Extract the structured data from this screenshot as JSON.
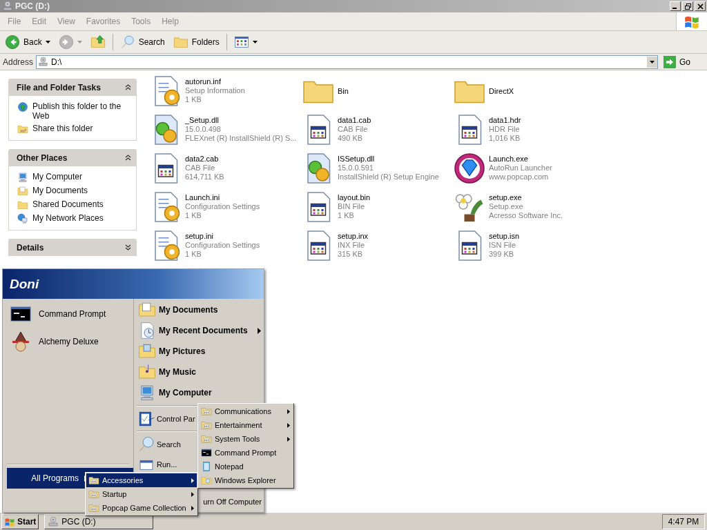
{
  "window": {
    "title": "PGC (D:)"
  },
  "menu_bar": [
    "File",
    "Edit",
    "View",
    "Favorites",
    "Tools",
    "Help"
  ],
  "toolbar": {
    "back": "Back",
    "forward": {
      "disabled": true
    },
    "search": "Search",
    "folders": "Folders"
  },
  "address": {
    "label": "Address",
    "value": "D:\\",
    "go": "Go"
  },
  "task_panels": [
    {
      "title": "File and Folder Tasks",
      "expanded": true,
      "items": [
        {
          "label": "Publish this folder to the Web",
          "kind": "globe"
        },
        {
          "label": "Share this folder",
          "kind": "share"
        }
      ]
    },
    {
      "title": "Other Places",
      "expanded": true,
      "items": [
        {
          "label": "My Computer",
          "kind": "computer"
        },
        {
          "label": "My Documents",
          "kind": "documents"
        },
        {
          "label": "Shared Documents",
          "kind": "folder"
        },
        {
          "label": "My Network Places",
          "kind": "network"
        }
      ]
    },
    {
      "title": "Details",
      "expanded": false
    }
  ],
  "files": [
    {
      "name": "autorun.inf",
      "kind": "config",
      "line_2": "Setup Information",
      "line_3": "1 KB"
    },
    {
      "name": "Bin",
      "kind": "folder"
    },
    {
      "name": "DirectX",
      "kind": "folder"
    },
    {
      "name": "_Setup.dll",
      "kind": "library",
      "line_2": "15.0.0.498",
      "line_3": "FLEXnet (R) InstallShield (R) S..."
    },
    {
      "name": "data1.cab",
      "kind": "package",
      "line_2": "CAB File",
      "line_3": "490 KB"
    },
    {
      "name": "data1.hdr",
      "kind": "package",
      "line_2": "HDR File",
      "line_3": "1,016 KB"
    },
    {
      "name": "data2.cab",
      "kind": "package",
      "line_2": "CAB File",
      "line_3": "614,711 KB"
    },
    {
      "name": "ISSetup.dll",
      "kind": "library",
      "line_2": "15.0.0.591",
      "line_3": "InstallShield (R) Setup Engine"
    },
    {
      "name": "Launch.exe",
      "kind": "gem",
      "line_2": "AutoRun Launcher",
      "line_3": "www.popcap.com"
    },
    {
      "name": "Launch.ini",
      "kind": "config",
      "line_2": "Configuration Settings",
      "line_3": "1 KB"
    },
    {
      "name": "layout.bin",
      "kind": "package",
      "line_2": "BIN File",
      "line_3": "1 KB"
    },
    {
      "name": "setup.exe",
      "kind": "flower",
      "line_2": "Setup.exe",
      "line_3": "Acresso Software Inc."
    },
    {
      "name": "setup.ini",
      "kind": "config",
      "line_2": "Configuration Settings",
      "line_3": "1 KB"
    },
    {
      "name": "setup.inx",
      "kind": "package",
      "line_2": "INX File",
      "line_3": "315 KB"
    },
    {
      "name": "setup.isn",
      "kind": "package",
      "line_2": "ISN File",
      "line_3": "399 KB"
    }
  ],
  "start_menu": {
    "user": "Doni",
    "pinned": [
      {
        "label": "Command Prompt",
        "kind": "console"
      },
      {
        "label": "Alchemy Deluxe",
        "kind": "hat"
      }
    ],
    "all_programs": {
      "label": "All Programs",
      "selected": true
    },
    "places": [
      {
        "label": "My Documents",
        "kind": "documents",
        "submenu": false
      },
      {
        "label": "My Recent Documents",
        "kind": "recent",
        "submenu": true
      },
      {
        "label": "My Pictures",
        "kind": "pictures",
        "submenu": false
      },
      {
        "label": "My Music",
        "kind": "music",
        "submenu": false
      },
      {
        "label": "My Computer",
        "kind": "computer",
        "submenu": false
      }
    ],
    "system": [
      {
        "label": "Control Par",
        "kind": "control"
      },
      {
        "label": "Search",
        "kind": "search"
      },
      {
        "label": "Run...",
        "kind": "run"
      }
    ],
    "turn_off": "urn Off Computer"
  },
  "programs_menu": [
    {
      "label": "Accessories",
      "kind": "progfolder",
      "submenu": true,
      "selected": true
    },
    {
      "label": "Startup",
      "kind": "progfolder",
      "submenu": true,
      "selected": false
    },
    {
      "label": "Popcap Game Collection",
      "kind": "progfolder",
      "submenu": true,
      "selected": false
    }
  ],
  "accessories_menu": [
    {
      "label": "Communications",
      "kind": "progfolder",
      "submenu": true
    },
    {
      "label": "Entertainment",
      "kind": "progfolder",
      "submenu": true
    },
    {
      "label": "System Tools",
      "kind": "progfolder",
      "submenu": true
    },
    {
      "label": "Command Prompt",
      "kind": "console",
      "submenu": false
    },
    {
      "label": "Notepad",
      "kind": "notepad",
      "submenu": false
    },
    {
      "label": "Windows Explorer",
      "kind": "explorer",
      "submenu": false
    }
  ],
  "taskbar": {
    "start": "Start",
    "tasks": [
      {
        "label": "PGC (D:)",
        "kind": "drive"
      }
    ],
    "clock": "4:47 PM"
  }
}
